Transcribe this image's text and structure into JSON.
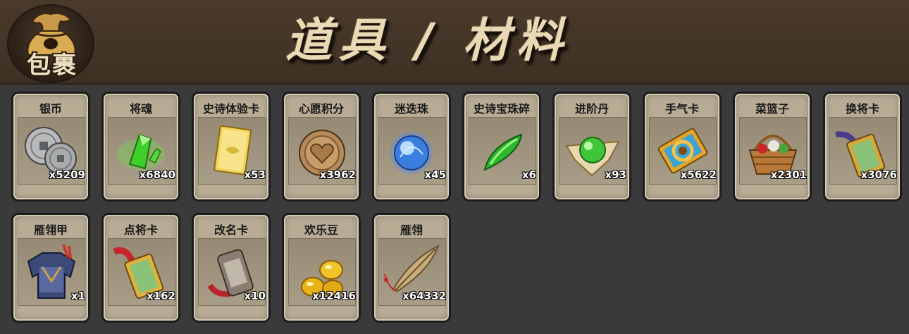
{
  "header": {
    "bag_label": "包裹",
    "title": "道具 / 材料"
  },
  "items": [
    {
      "name": "银币",
      "count": "x5209",
      "icon": "silver-coins-icon"
    },
    {
      "name": "将魂",
      "count": "x6840",
      "icon": "green-crystal-icon"
    },
    {
      "name": "史诗体验卡",
      "count": "x53",
      "icon": "gold-card-icon"
    },
    {
      "name": "心愿积分",
      "count": "x3962",
      "icon": "heart-coin-icon"
    },
    {
      "name": "迷迭珠",
      "count": "x45",
      "icon": "blue-orb-icon"
    },
    {
      "name": "史诗宝珠碎",
      "count": "x6",
      "icon": "green-shard-icon"
    },
    {
      "name": "进阶丹",
      "count": "x93",
      "icon": "green-pill-icon"
    },
    {
      "name": "手气卡",
      "count": "x5622",
      "icon": "luck-card-icon"
    },
    {
      "name": "菜篮子",
      "count": "x2301",
      "icon": "basket-icon"
    },
    {
      "name": "换将卡",
      "count": "x3076",
      "icon": "swap-general-card-icon"
    },
    {
      "name": "雁翎甲",
      "count": "x1",
      "icon": "armor-icon"
    },
    {
      "name": "点将卡",
      "count": "x162",
      "icon": "general-card-icon"
    },
    {
      "name": "改名卡",
      "count": "x10",
      "icon": "rename-card-icon"
    },
    {
      "name": "欢乐豆",
      "count": "x12416",
      "icon": "gold-beans-icon"
    },
    {
      "name": "雁翎",
      "count": "x64332",
      "icon": "feather-icon"
    }
  ]
}
